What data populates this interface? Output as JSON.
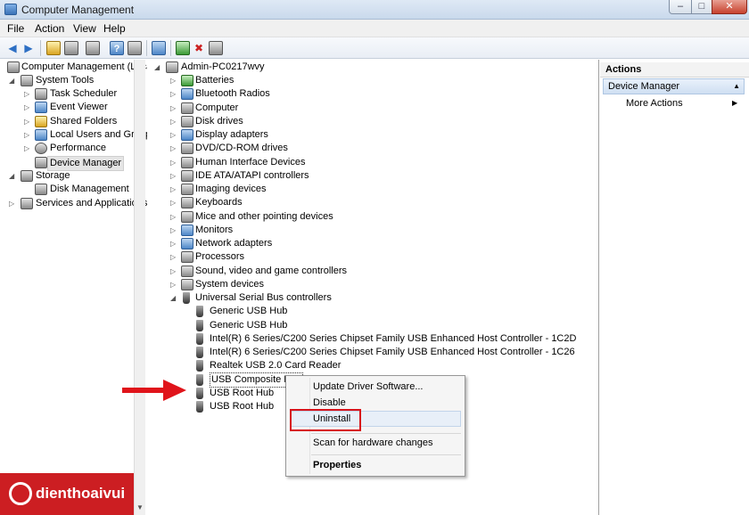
{
  "window": {
    "title": "Computer Management"
  },
  "menu": [
    "File",
    "Action",
    "View",
    "Help"
  ],
  "left_tree": [
    {
      "label": "Computer Management (Local"
    },
    {
      "label": "System Tools"
    },
    {
      "label": "Task Scheduler"
    },
    {
      "label": "Event Viewer"
    },
    {
      "label": "Shared Folders"
    },
    {
      "label": "Local Users and Groups"
    },
    {
      "label": "Performance"
    },
    {
      "label": "Device Manager"
    },
    {
      "label": "Storage"
    },
    {
      "label": "Disk Management"
    },
    {
      "label": "Services and Applications"
    }
  ],
  "device_tree": {
    "root": "Admin-PC0217wvy",
    "categories": [
      "Batteries",
      "Bluetooth Radios",
      "Computer",
      "Disk drives",
      "Display adapters",
      "DVD/CD-ROM drives",
      "Human Interface Devices",
      "IDE ATA/ATAPI controllers",
      "Imaging devices",
      "Keyboards",
      "Mice and other pointing devices",
      "Monitors",
      "Network adapters",
      "Processors",
      "Sound, video and game controllers",
      "System devices",
      "Universal Serial Bus controllers"
    ],
    "usb_children": [
      "Generic USB Hub",
      "Generic USB Hub",
      "Intel(R) 6 Series/C200 Series Chipset Family USB Enhanced Host Controller - 1C2D",
      "Intel(R) 6 Series/C200 Series Chipset Family USB Enhanced Host Controller - 1C26",
      "Realtek USB 2.0 Card Reader",
      "USB Composite Dev",
      "USB Root Hub",
      "USB Root Hub"
    ]
  },
  "actions": {
    "header": "Actions",
    "section": "Device Manager",
    "more": "More Actions"
  },
  "context_menu": {
    "items": [
      "Update Driver Software...",
      "Disable",
      "Uninstall",
      "Scan for hardware changes",
      "Properties"
    ]
  },
  "watermark": {
    "brand": "dienthoaivui"
  },
  "colors": {
    "highlight_box": "#d7131b",
    "arrow": "#e0141b",
    "brand": "#cc1e22"
  }
}
